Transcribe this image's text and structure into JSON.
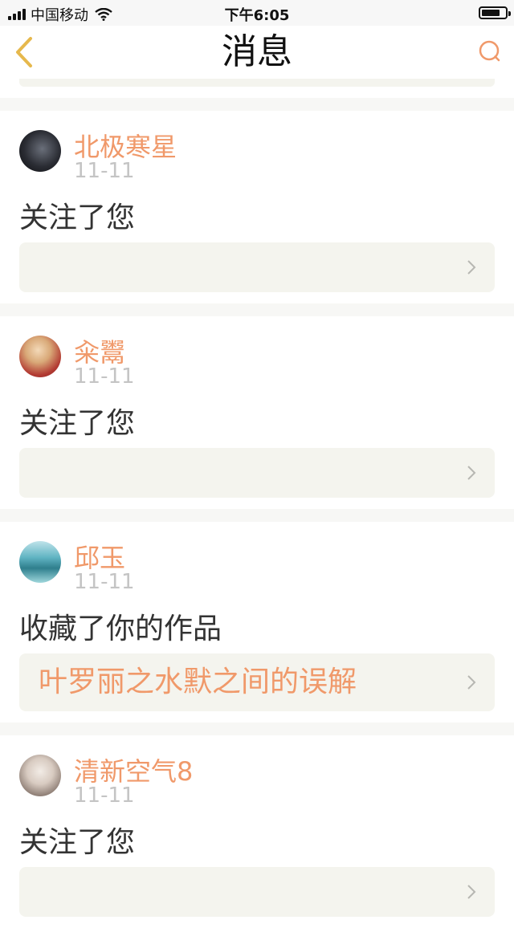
{
  "status_bar": {
    "carrier": "中国移动",
    "time": "下午6:05"
  },
  "header": {
    "title": "消息"
  },
  "messages": [
    {
      "user": "北极寒星",
      "date": "11-11",
      "action": "关注了您",
      "reference": ""
    },
    {
      "user": "籴鬻",
      "date": "11-11",
      "action": "关注了您",
      "reference": ""
    },
    {
      "user": "邱玉",
      "date": "11-11",
      "action": "收藏了你的作品",
      "reference": "叶罗丽之水默之间的误解"
    },
    {
      "user": "清新空气8",
      "date": "11-11",
      "action": "关注了您",
      "reference": ""
    }
  ],
  "colors": {
    "accent": "#f0996a",
    "nav_back": "#e6b84c",
    "date": "#c4c4c4",
    "ref_bg": "#f4f4ee"
  },
  "icons": {
    "back": "chevron-left-icon",
    "search": "search-icon",
    "ref": "chevron-right-icon"
  }
}
